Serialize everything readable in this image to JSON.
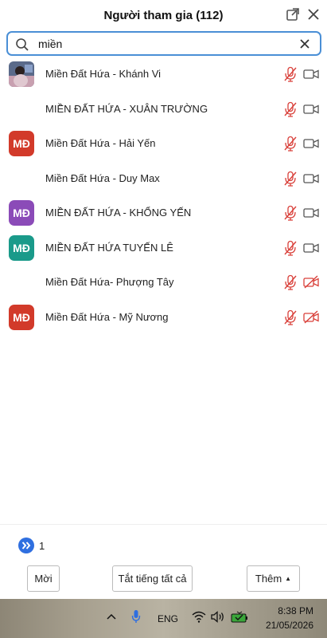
{
  "header": {
    "title": "Người tham gia (112)",
    "popout_icon": "popout-icon",
    "close_icon": "close-icon"
  },
  "search": {
    "value": "miền",
    "icon": "search-icon",
    "clear_icon": "clear-icon",
    "border_color": "#4a8fd6"
  },
  "participants": [
    {
      "name": "Miền Đất Hứa - Khánh Vi",
      "avatar_type": "photo",
      "initials": "",
      "avatar_color": "",
      "mic": "muted",
      "cam": "on"
    },
    {
      "name": "MIỀN ĐẤT HỨA - XUÂN TRƯỜNG",
      "avatar_type": "none",
      "initials": "",
      "avatar_color": "",
      "mic": "muted",
      "cam": "on"
    },
    {
      "name": "Miền Đất Hứa - Hải Yến",
      "avatar_type": "initials",
      "initials": "MĐ",
      "avatar_color": "#d23a2a",
      "mic": "muted",
      "cam": "on"
    },
    {
      "name": "Miền Đất Hứa - Duy Max",
      "avatar_type": "none",
      "initials": "",
      "avatar_color": "",
      "mic": "muted",
      "cam": "on"
    },
    {
      "name": "MIỀN ĐẤT HỨA - KHỔNG YẾN",
      "avatar_type": "initials",
      "initials": "MĐ",
      "avatar_color": "#8b4bb8",
      "mic": "muted",
      "cam": "on"
    },
    {
      "name": "MIỀN ĐẤT HỨA TUYẾN LÊ",
      "avatar_type": "initials",
      "initials": "MĐ",
      "avatar_color": "#1a9a8a",
      "mic": "muted",
      "cam": "on"
    },
    {
      "name": "Miền Đất Hứa- Phượng Tây",
      "avatar_type": "none",
      "initials": "",
      "avatar_color": "",
      "mic": "muted",
      "cam": "off"
    },
    {
      "name": "Miền Đất Hứa - Mỹ Nương",
      "avatar_type": "initials",
      "initials": "MĐ",
      "avatar_color": "#d23a2a",
      "mic": "muted",
      "cam": "off"
    }
  ],
  "pager": {
    "icon": "double-chevron-right-icon",
    "page": "1"
  },
  "footer": {
    "invite_label": "Mời",
    "mute_all_label": "Tắt tiếng tất cả",
    "more_label": "Thêm"
  },
  "taskbar": {
    "language": "ENG",
    "time": "8:38 PM",
    "date": "21/05/2026"
  },
  "colors": {
    "muted_red": "#d9403a",
    "icon_gray": "#555555",
    "pager_blue": "#2f6fe0"
  }
}
